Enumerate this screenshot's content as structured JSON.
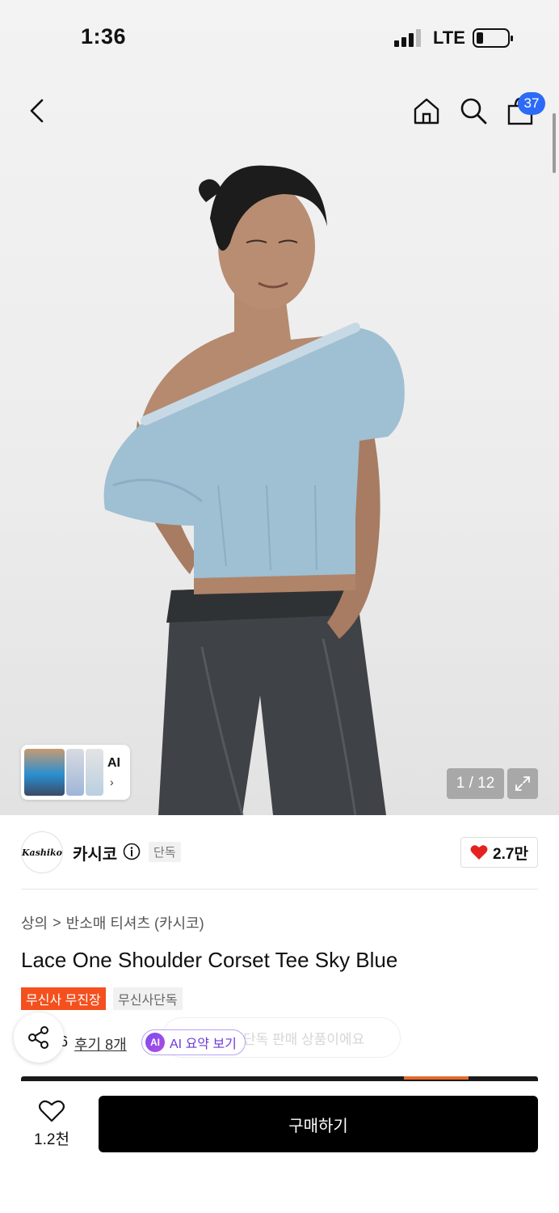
{
  "status_bar": {
    "time": "1:36",
    "network": "LTE"
  },
  "header": {
    "cart_count": "37"
  },
  "gallery": {
    "counter": "1 / 12",
    "ai_label": "AI",
    "ai_chevron": "›"
  },
  "brand": {
    "name": "카시코",
    "logo_text": "Kashiko",
    "exclusive_label": "단독"
  },
  "likes": {
    "count": "2.7만"
  },
  "breadcrumb": {
    "level1": "상의",
    "separator": ">",
    "level2": "반소매 티셔츠 (카시코)"
  },
  "product": {
    "title": "Lace One Shoulder Corset Tee Sky Blue"
  },
  "tags": {
    "red": "무신사 무진장",
    "gray": "무신사단독"
  },
  "reviews": {
    "rating_partial": "6",
    "review_label": "후기 8개",
    "ai_summary": "AI 요약 보기",
    "ai_badge": "AI"
  },
  "toast": {
    "text": "단독 판매 상품이에요"
  },
  "bottom": {
    "wishlist_count": "1.2천",
    "buy_label": "구매하기"
  },
  "colors": {
    "accent_blue": "#2c6bf5",
    "tag_red": "#f4501e",
    "ai_purple": "#6d3ad9",
    "heart_red": "#e52222"
  }
}
